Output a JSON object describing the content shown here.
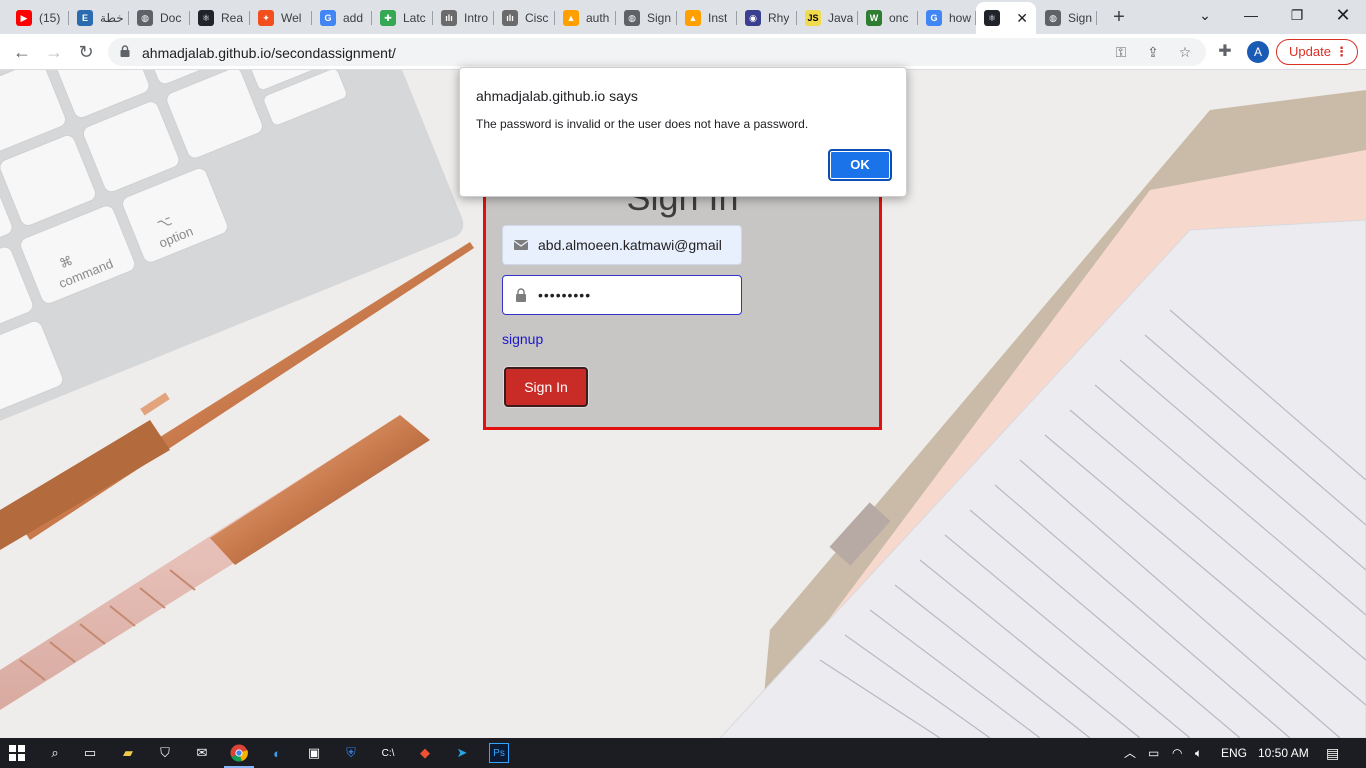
{
  "browser": {
    "tabs": [
      {
        "label": "(15)",
        "icon": "youtube-icon",
        "color": "#ff0000",
        "glyph": "▶"
      },
      {
        "label": "خطة",
        "icon": "e-letter-icon",
        "color": "#2b6cb0",
        "glyph": "E"
      },
      {
        "label": "Doc",
        "icon": "globe-icon",
        "color": "#5f6368",
        "glyph": "◍"
      },
      {
        "label": "Rea",
        "icon": "react-icon",
        "color": "#20232a",
        "glyph": "⚛"
      },
      {
        "label": "Wel",
        "icon": "figma-icon",
        "color": "#f24e1e",
        "glyph": "✦"
      },
      {
        "label": "add",
        "icon": "google-icon",
        "color": "#4285f4",
        "glyph": "G"
      },
      {
        "label": "Latc",
        "icon": "puzzle-icon",
        "color": "#34a853",
        "glyph": "✚"
      },
      {
        "label": "Intro",
        "icon": "cisco-icon",
        "color": "#6b6b6b",
        "glyph": "ılı"
      },
      {
        "label": "Cisc",
        "icon": "cisco-icon",
        "color": "#6b6b6b",
        "glyph": "ılı"
      },
      {
        "label": "auth",
        "icon": "firebase-icon",
        "color": "#ffa000",
        "glyph": "▲"
      },
      {
        "label": "Sign",
        "icon": "globe-icon",
        "color": "#5f6368",
        "glyph": "◍"
      },
      {
        "label": "Inst",
        "icon": "firebase-icon",
        "color": "#ffa000",
        "glyph": "▲"
      },
      {
        "label": "Rhy",
        "icon": "discord-icon",
        "color": "#3b3f8f",
        "glyph": "◉"
      },
      {
        "label": "Java",
        "icon": "js-icon",
        "color": "#f0db4f",
        "glyph": "JS"
      },
      {
        "label": "onc",
        "icon": "w-icon",
        "color": "#2e7d32",
        "glyph": "W"
      },
      {
        "label": "how",
        "icon": "google-icon",
        "color": "#4285f4",
        "glyph": "G"
      },
      {
        "label": "",
        "icon": "react-icon",
        "color": "#20232a",
        "glyph": "⚛",
        "active": true
      },
      {
        "label": "Sign",
        "icon": "globe-icon",
        "color": "#5f6368",
        "glyph": "◍"
      }
    ],
    "url": "ahmadjalab.github.io/secondassignment/",
    "avatar_letter": "A",
    "update_label": "Update"
  },
  "signin": {
    "title": "Sign In",
    "email_value": "abd.almoeen.katmawi@gmail",
    "password_value": "•••••••••",
    "signup_link": "signup",
    "button_label": "Sign In"
  },
  "alert": {
    "title": "ahmadjalab.github.io says",
    "message": "The password is invalid or the user does not have a password.",
    "ok_label": "OK"
  },
  "taskbar": {
    "language": "ENG",
    "time": "10:50 AM"
  },
  "colors": {
    "card_border": "#e0110f",
    "signin_button": "#c92b27",
    "signup_link": "#1a18c8",
    "ok_button": "#1a73e8",
    "update_red": "#d93025"
  }
}
